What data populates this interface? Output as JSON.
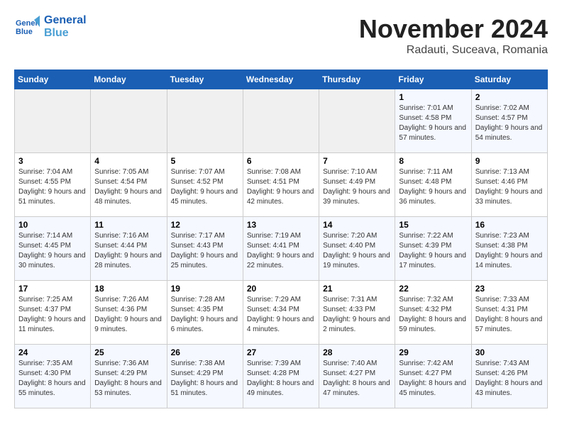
{
  "logo": {
    "line1": "General",
    "line2": "Blue"
  },
  "title": "November 2024",
  "location": "Radauti, Suceava, Romania",
  "weekdays": [
    "Sunday",
    "Monday",
    "Tuesday",
    "Wednesday",
    "Thursday",
    "Friday",
    "Saturday"
  ],
  "weeks": [
    [
      {
        "day": "",
        "info": ""
      },
      {
        "day": "",
        "info": ""
      },
      {
        "day": "",
        "info": ""
      },
      {
        "day": "",
        "info": ""
      },
      {
        "day": "",
        "info": ""
      },
      {
        "day": "1",
        "info": "Sunrise: 7:01 AM\nSunset: 4:58 PM\nDaylight: 9 hours and 57 minutes."
      },
      {
        "day": "2",
        "info": "Sunrise: 7:02 AM\nSunset: 4:57 PM\nDaylight: 9 hours and 54 minutes."
      }
    ],
    [
      {
        "day": "3",
        "info": "Sunrise: 7:04 AM\nSunset: 4:55 PM\nDaylight: 9 hours and 51 minutes."
      },
      {
        "day": "4",
        "info": "Sunrise: 7:05 AM\nSunset: 4:54 PM\nDaylight: 9 hours and 48 minutes."
      },
      {
        "day": "5",
        "info": "Sunrise: 7:07 AM\nSunset: 4:52 PM\nDaylight: 9 hours and 45 minutes."
      },
      {
        "day": "6",
        "info": "Sunrise: 7:08 AM\nSunset: 4:51 PM\nDaylight: 9 hours and 42 minutes."
      },
      {
        "day": "7",
        "info": "Sunrise: 7:10 AM\nSunset: 4:49 PM\nDaylight: 9 hours and 39 minutes."
      },
      {
        "day": "8",
        "info": "Sunrise: 7:11 AM\nSunset: 4:48 PM\nDaylight: 9 hours and 36 minutes."
      },
      {
        "day": "9",
        "info": "Sunrise: 7:13 AM\nSunset: 4:46 PM\nDaylight: 9 hours and 33 minutes."
      }
    ],
    [
      {
        "day": "10",
        "info": "Sunrise: 7:14 AM\nSunset: 4:45 PM\nDaylight: 9 hours and 30 minutes."
      },
      {
        "day": "11",
        "info": "Sunrise: 7:16 AM\nSunset: 4:44 PM\nDaylight: 9 hours and 28 minutes."
      },
      {
        "day": "12",
        "info": "Sunrise: 7:17 AM\nSunset: 4:43 PM\nDaylight: 9 hours and 25 minutes."
      },
      {
        "day": "13",
        "info": "Sunrise: 7:19 AM\nSunset: 4:41 PM\nDaylight: 9 hours and 22 minutes."
      },
      {
        "day": "14",
        "info": "Sunrise: 7:20 AM\nSunset: 4:40 PM\nDaylight: 9 hours and 19 minutes."
      },
      {
        "day": "15",
        "info": "Sunrise: 7:22 AM\nSunset: 4:39 PM\nDaylight: 9 hours and 17 minutes."
      },
      {
        "day": "16",
        "info": "Sunrise: 7:23 AM\nSunset: 4:38 PM\nDaylight: 9 hours and 14 minutes."
      }
    ],
    [
      {
        "day": "17",
        "info": "Sunrise: 7:25 AM\nSunset: 4:37 PM\nDaylight: 9 hours and 11 minutes."
      },
      {
        "day": "18",
        "info": "Sunrise: 7:26 AM\nSunset: 4:36 PM\nDaylight: 9 hours and 9 minutes."
      },
      {
        "day": "19",
        "info": "Sunrise: 7:28 AM\nSunset: 4:35 PM\nDaylight: 9 hours and 6 minutes."
      },
      {
        "day": "20",
        "info": "Sunrise: 7:29 AM\nSunset: 4:34 PM\nDaylight: 9 hours and 4 minutes."
      },
      {
        "day": "21",
        "info": "Sunrise: 7:31 AM\nSunset: 4:33 PM\nDaylight: 9 hours and 2 minutes."
      },
      {
        "day": "22",
        "info": "Sunrise: 7:32 AM\nSunset: 4:32 PM\nDaylight: 8 hours and 59 minutes."
      },
      {
        "day": "23",
        "info": "Sunrise: 7:33 AM\nSunset: 4:31 PM\nDaylight: 8 hours and 57 minutes."
      }
    ],
    [
      {
        "day": "24",
        "info": "Sunrise: 7:35 AM\nSunset: 4:30 PM\nDaylight: 8 hours and 55 minutes."
      },
      {
        "day": "25",
        "info": "Sunrise: 7:36 AM\nSunset: 4:29 PM\nDaylight: 8 hours and 53 minutes."
      },
      {
        "day": "26",
        "info": "Sunrise: 7:38 AM\nSunset: 4:29 PM\nDaylight: 8 hours and 51 minutes."
      },
      {
        "day": "27",
        "info": "Sunrise: 7:39 AM\nSunset: 4:28 PM\nDaylight: 8 hours and 49 minutes."
      },
      {
        "day": "28",
        "info": "Sunrise: 7:40 AM\nSunset: 4:27 PM\nDaylight: 8 hours and 47 minutes."
      },
      {
        "day": "29",
        "info": "Sunrise: 7:42 AM\nSunset: 4:27 PM\nDaylight: 8 hours and 45 minutes."
      },
      {
        "day": "30",
        "info": "Sunrise: 7:43 AM\nSunset: 4:26 PM\nDaylight: 8 hours and 43 minutes."
      }
    ]
  ]
}
